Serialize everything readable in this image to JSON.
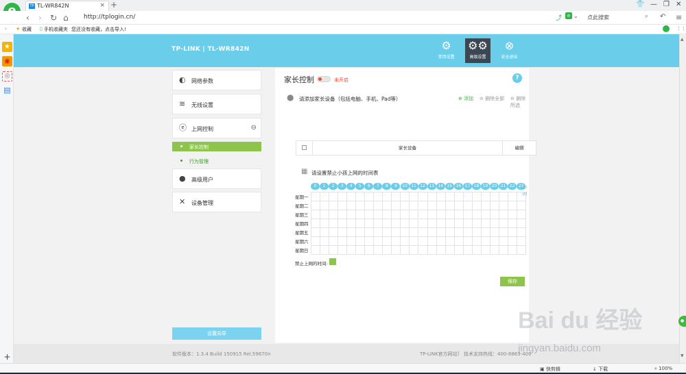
{
  "browser": {
    "tab_title": "TL-WR842N",
    "tab_favicon": "TP",
    "new_tab": "+",
    "url": "http://tplogin.cn/",
    "search_placeholder": "点此搜索",
    "bookmarks": [
      "收藏",
      "手机收藏夹",
      "您还没有收藏，点击导入!"
    ],
    "brand_color": "#2fb54a"
  },
  "router": {
    "brand": "TP-LINK  |  TL-WR842N",
    "header_color": "#6acde9",
    "top_buttons": [
      {
        "label": "常用设置",
        "icon": "gear-icon"
      },
      {
        "label": "高级设置",
        "icon": "gears-icon",
        "active": true
      },
      {
        "label": "安全退出",
        "icon": "exit-icon"
      }
    ],
    "menu": [
      {
        "label": "网络参数",
        "icon": "globe-icon"
      },
      {
        "label": "无线设置",
        "icon": "wifi-icon"
      },
      {
        "label": "上网控制",
        "icon": "internet-control-icon"
      },
      {
        "label": "高级用户",
        "icon": "user-icon"
      },
      {
        "label": "设备管理",
        "icon": "tools-icon"
      }
    ],
    "submenu": [
      {
        "label": "家长控制",
        "active": true
      },
      {
        "label": "行为管理"
      }
    ],
    "wizard_label": "设置向导"
  },
  "panel": {
    "title": "家长控制",
    "toggle_state": "未开启",
    "help": "?",
    "device_section": "请添加家长设备（包括电脑、手机、Pad等）",
    "actions": [
      "添加",
      "删除全部",
      "删除所选"
    ],
    "table_headers": [
      "家长设备",
      "编辑"
    ],
    "schedule_section": "请设置禁止小孩上网的时间表",
    "hours": [
      "0",
      "1",
      "2",
      "3",
      "4",
      "5",
      "6",
      "7",
      "8",
      "9",
      "10",
      "11",
      "12",
      "13",
      "14",
      "15",
      "16",
      "17",
      "18",
      "19",
      "20",
      "21",
      "22",
      "23"
    ],
    "hour_unit": "小时",
    "days": [
      "星期一",
      "星期二",
      "星期三",
      "星期四",
      "星期五",
      "星期六",
      "星期日"
    ],
    "legend_label": "禁止上网的时间:",
    "legend_color": "#8dc54c",
    "save_label": "保存"
  },
  "footer": {
    "version": "软件版本：1.3.4 Build 150915 Rel.59670n",
    "site": "TP-LINK官方网站",
    "hotline": "技术支持热线：400-8863-400"
  },
  "statusbar": {
    "items": [
      "快剪辑",
      "下载",
      "100%"
    ]
  },
  "watermark": {
    "mark": "Bai du 经验",
    "site": "jingyan.baidu.com"
  }
}
